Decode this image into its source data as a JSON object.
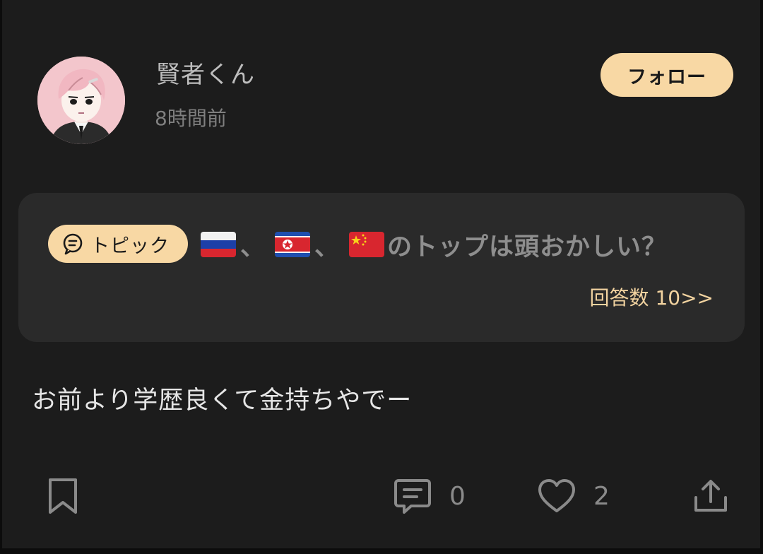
{
  "post": {
    "username": "賢者くん",
    "timestamp": "8時間前",
    "follow_label": "フォロー",
    "body": "お前より学歴良くて金持ちやでー"
  },
  "topic": {
    "chip_label": "トピック",
    "flags": [
      "flag-russia",
      "flag-north-korea",
      "flag-china"
    ],
    "separator": "、",
    "title_text": "のトップは頭おかしい？",
    "answers_label": "回答数 10>>"
  },
  "actions": {
    "comment_count": "0",
    "like_count": "2"
  },
  "colors": {
    "accent": "#f8d8a4",
    "background": "#1c1c1c",
    "card": "#2a2a2a",
    "answers_link": "#f2d3a0"
  },
  "icons": {
    "bookmark": "bookmark-icon",
    "comment": "comment-icon",
    "like": "heart-icon",
    "share": "share-icon",
    "topic": "chat-bubble-icon"
  }
}
